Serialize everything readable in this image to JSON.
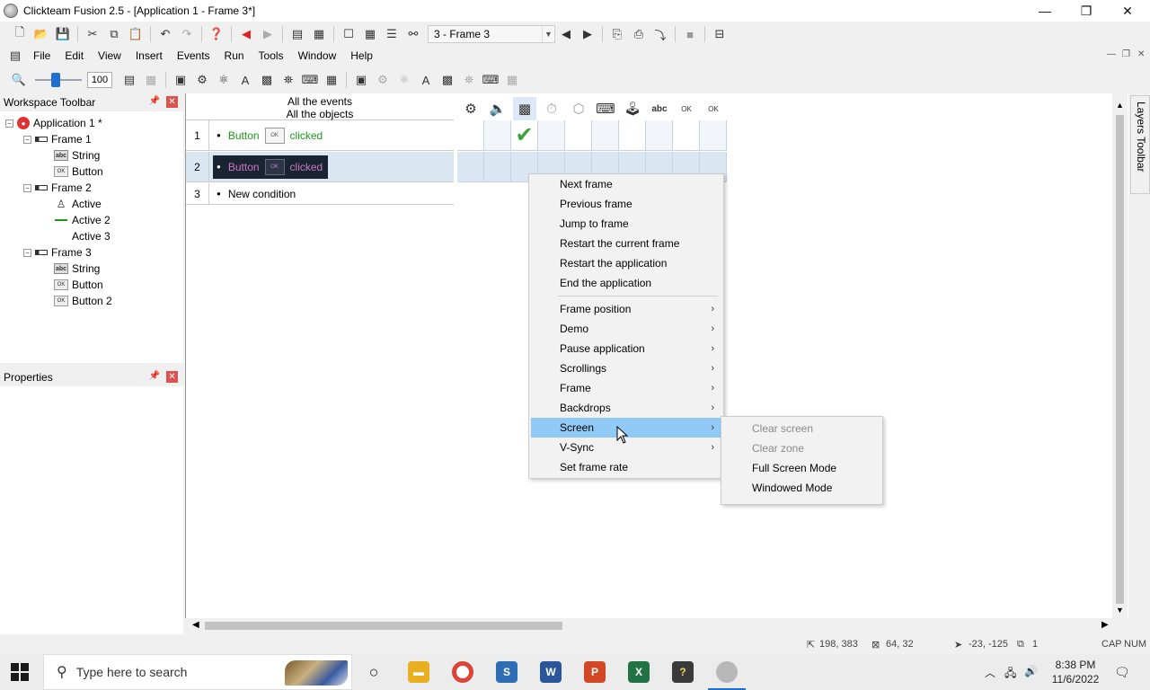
{
  "window": {
    "title": "Clickteam Fusion 2.5 - [Application 1 - Frame 3*]",
    "min_glyph": "—",
    "max_glyph": "❐",
    "close_glyph": "✕"
  },
  "toolbar": {
    "frame_selector": "3 - Frame 3"
  },
  "menubar": {
    "items": [
      "File",
      "Edit",
      "View",
      "Insert",
      "Events",
      "Run",
      "Tools",
      "Window",
      "Help"
    ]
  },
  "zoom": {
    "value": "100"
  },
  "workspace": {
    "title": "Workspace Toolbar",
    "tree": [
      {
        "label": "Application 1 *",
        "type": "app"
      },
      {
        "label": "Frame 1",
        "type": "frame"
      },
      {
        "label": "String",
        "type": "string"
      },
      {
        "label": "Button",
        "type": "button"
      },
      {
        "label": "Frame 2",
        "type": "frame"
      },
      {
        "label": "Active",
        "type": "active"
      },
      {
        "label": "Active 2",
        "type": "active-line"
      },
      {
        "label": "Active 3",
        "type": "active-none"
      },
      {
        "label": "Frame 3",
        "type": "frame"
      },
      {
        "label": "String",
        "type": "string"
      },
      {
        "label": "Button",
        "type": "button"
      },
      {
        "label": "Button 2",
        "type": "button"
      }
    ]
  },
  "properties": {
    "title": "Properties"
  },
  "event_editor": {
    "header_line1": "All the events",
    "header_line2": "All the objects",
    "rows": [
      {
        "num": "1",
        "object": "Button",
        "condition": "clicked"
      },
      {
        "num": "2",
        "object": "Button",
        "condition": "clicked"
      },
      {
        "num": "3",
        "text": "New condition"
      }
    ],
    "checkmark": "✔"
  },
  "context_menu": {
    "items": [
      {
        "label": "Next frame"
      },
      {
        "label": "Previous frame"
      },
      {
        "label": "Jump to frame"
      },
      {
        "label": "Restart the current frame"
      },
      {
        "label": "Restart the application"
      },
      {
        "label": "End the application"
      },
      {
        "label": "Frame position",
        "submenu": true
      },
      {
        "label": "Demo",
        "submenu": true
      },
      {
        "label": "Pause application",
        "submenu": true
      },
      {
        "label": "Scrollings",
        "submenu": true
      },
      {
        "label": "Frame",
        "submenu": true
      },
      {
        "label": "Backdrops",
        "submenu": true
      },
      {
        "label": "Screen",
        "submenu": true
      },
      {
        "label": "V-Sync",
        "submenu": true
      },
      {
        "label": "Set frame rate"
      }
    ],
    "highlighted": "Screen",
    "submenu_arrow": "›"
  },
  "screen_submenu": {
    "items": [
      {
        "label": "Clear screen",
        "disabled": true
      },
      {
        "label": "Clear zone",
        "disabled": true
      },
      {
        "label": "Full Screen Mode",
        "disabled": false
      },
      {
        "label": "Windowed Mode",
        "disabled": false
      }
    ]
  },
  "layers_toolbar": {
    "label": "Layers Toolbar"
  },
  "statusbar": {
    "pos": "198, 383",
    "size": "64, 32",
    "offset": "-23, -125",
    "layer": "1",
    "caps": "CAP",
    "num": "NUM"
  },
  "taskbar": {
    "search_placeholder": "Type here to search",
    "time": "8:38 PM",
    "date": "11/6/2022"
  },
  "colors": {
    "highlight": "#91c9f7",
    "green_text": "#1a9a1a",
    "selected_row_bg": "#1a2332",
    "selected_text": "#c77ac0",
    "close_red": "#d9534f"
  }
}
